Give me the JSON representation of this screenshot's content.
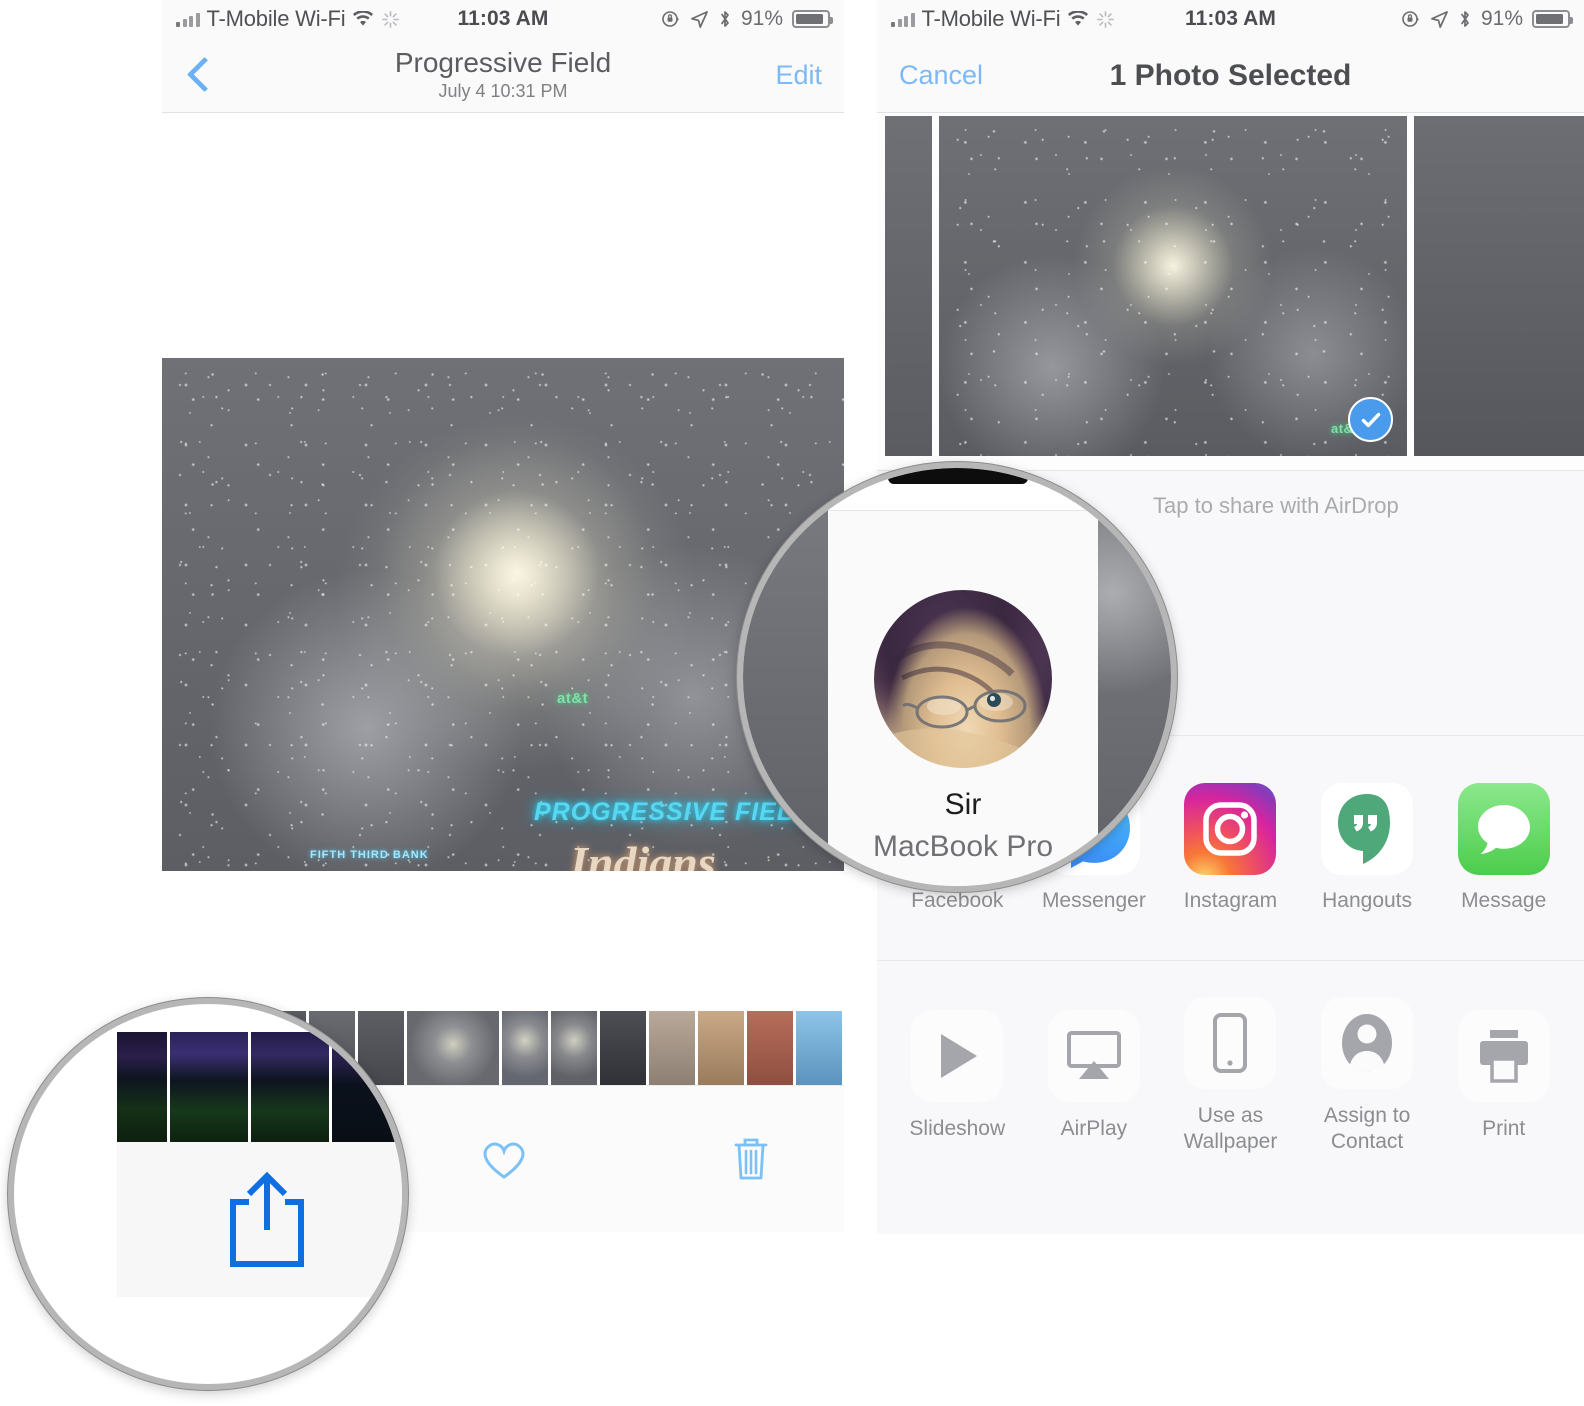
{
  "status_bar": {
    "carrier": "T-Mobile Wi-Fi",
    "time": "11:03 AM",
    "battery_percent": "91%",
    "icons": [
      "signal-bars-icon",
      "wifi-icon",
      "sync-spinner-icon",
      "rotation-lock-icon",
      "location-arrow-icon",
      "bluetooth-icon",
      "battery-icon"
    ]
  },
  "left_panel": {
    "nav": {
      "back_icon": "chevron-left-icon",
      "title": "Progressive Field",
      "subtitle": "July 4  10:31 PM",
      "edit_label": "Edit"
    },
    "photo": {
      "sign_primary": "PROGRESSIVE FIELD",
      "sign_secondary": "Indians",
      "sign_sponsor": "FIFTH THIRD BANK",
      "sign_carrier": "at&t"
    },
    "toolbar": {
      "share_icon": "share-upload-icon",
      "favorite_icon": "heart-icon",
      "delete_icon": "trash-icon"
    }
  },
  "right_panel": {
    "nav": {
      "cancel_label": "Cancel",
      "title": "1 Photo Selected"
    },
    "selection": {
      "selected_badge_icon": "checkmark-circle-icon",
      "selected_count": 1
    },
    "share_sheet": {
      "airdrop_hint": "Tap to share with AirDrop",
      "apps": [
        {
          "label": "Facebook",
          "icon": "facebook-icon",
          "color": "#3b5998"
        },
        {
          "label": "Messenger",
          "icon": "messenger-icon",
          "color": "#0084ff"
        },
        {
          "label": "Instagram",
          "icon": "instagram-icon",
          "color": "#e1306c"
        },
        {
          "label": "Hangouts",
          "icon": "hangouts-icon",
          "color": "#0f9d58"
        },
        {
          "label": "Message",
          "icon": "message-bubble-icon",
          "color": "#5bd75b"
        }
      ],
      "actions": [
        {
          "label": "Slideshow",
          "icon": "play-triangle-icon"
        },
        {
          "label": "AirPlay",
          "icon": "airplay-icon"
        },
        {
          "label": "Use as Wallpaper",
          "icon": "phone-wallpaper-icon"
        },
        {
          "label": "Assign to Contact",
          "icon": "contact-person-icon"
        },
        {
          "label": "Print",
          "icon": "printer-icon"
        }
      ]
    }
  },
  "callouts": {
    "airdrop": {
      "contact_name": "Sir",
      "device_name": "MacBook Pro",
      "avatar_icon": "avatar-photo"
    },
    "share_button": {
      "icon": "share-upload-icon",
      "accent_color": "#0f6fe0"
    }
  },
  "colors": {
    "ios_blue": "#7cb9f7",
    "share_blue": "#0f6fe0",
    "selection_blue": "#4a9bec",
    "panel_bg": "#fdfdfd",
    "sheet_bg": "#f8f8fa"
  }
}
